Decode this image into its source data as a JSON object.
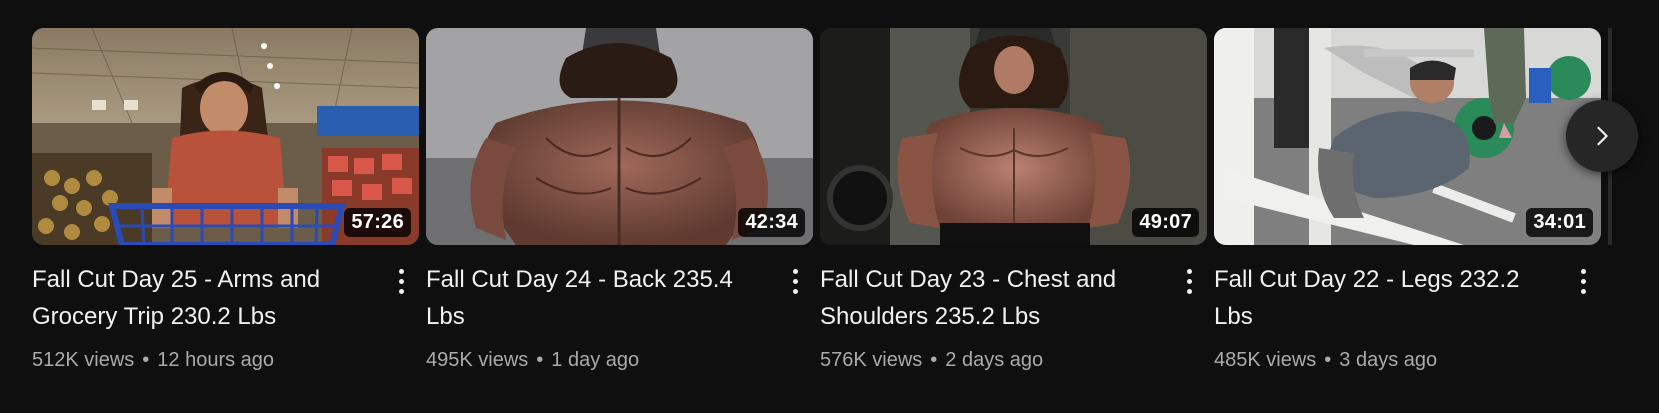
{
  "videos": [
    {
      "title": "Fall Cut Day 25 - Arms and Grocery Trip 230.2 Lbs",
      "duration": "57:26",
      "views": "512K views",
      "age": "12 hours ago",
      "thumbnail": "man pushing blue shopping cart in grocery store"
    },
    {
      "title": "Fall Cut Day 24 - Back 235.4 Lbs",
      "duration": "42:34",
      "views": "495K views",
      "age": "1 day ago",
      "thumbnail": "bodybuilder back pose against grey wall"
    },
    {
      "title": "Fall Cut Day 23 - Chest and Shoulders 235.2 Lbs",
      "duration": "49:07",
      "views": "576K views",
      "age": "2 days ago",
      "thumbnail": "bodybuilder front pose in gym"
    },
    {
      "title": "Fall Cut Day 22 - Legs 232.2 Lbs",
      "duration": "34:01",
      "views": "485K views",
      "age": "3 days ago",
      "thumbnail": "man on leg press machine in gym"
    }
  ],
  "separator": "•",
  "icons": {
    "menu": "more-vert-icon",
    "next": "chevron-right-icon"
  },
  "colors": {
    "background": "#0f0f0f",
    "title": "#f1f1f1",
    "meta": "#aaaaaa"
  }
}
